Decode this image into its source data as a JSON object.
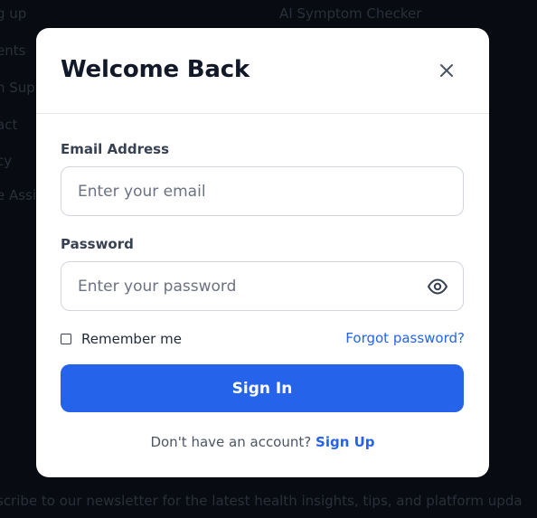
{
  "background": {
    "fragments": [
      "g up",
      "ents",
      "h Sup",
      "act",
      "cy",
      "e Assi",
      "AI Symptom Checker",
      "scribe to our newsletter for the latest health insights, tips, and platform upda"
    ]
  },
  "modal": {
    "title": "Welcome Back",
    "close_icon": "close-icon",
    "email": {
      "label": "Email Address",
      "placeholder": "Enter your email",
      "value": ""
    },
    "password": {
      "label": "Password",
      "placeholder": "Enter your password",
      "value": "",
      "toggle_icon": "eye-icon"
    },
    "remember_label": "Remember me",
    "remember_checked": false,
    "forgot_label": "Forgot password?",
    "submit_label": "Sign In",
    "footer_text": "Don't have an account?",
    "signup_label": "Sign Up"
  },
  "colors": {
    "accent": "#2563eb",
    "backdrop": "#080b12",
    "title": "#111827"
  }
}
